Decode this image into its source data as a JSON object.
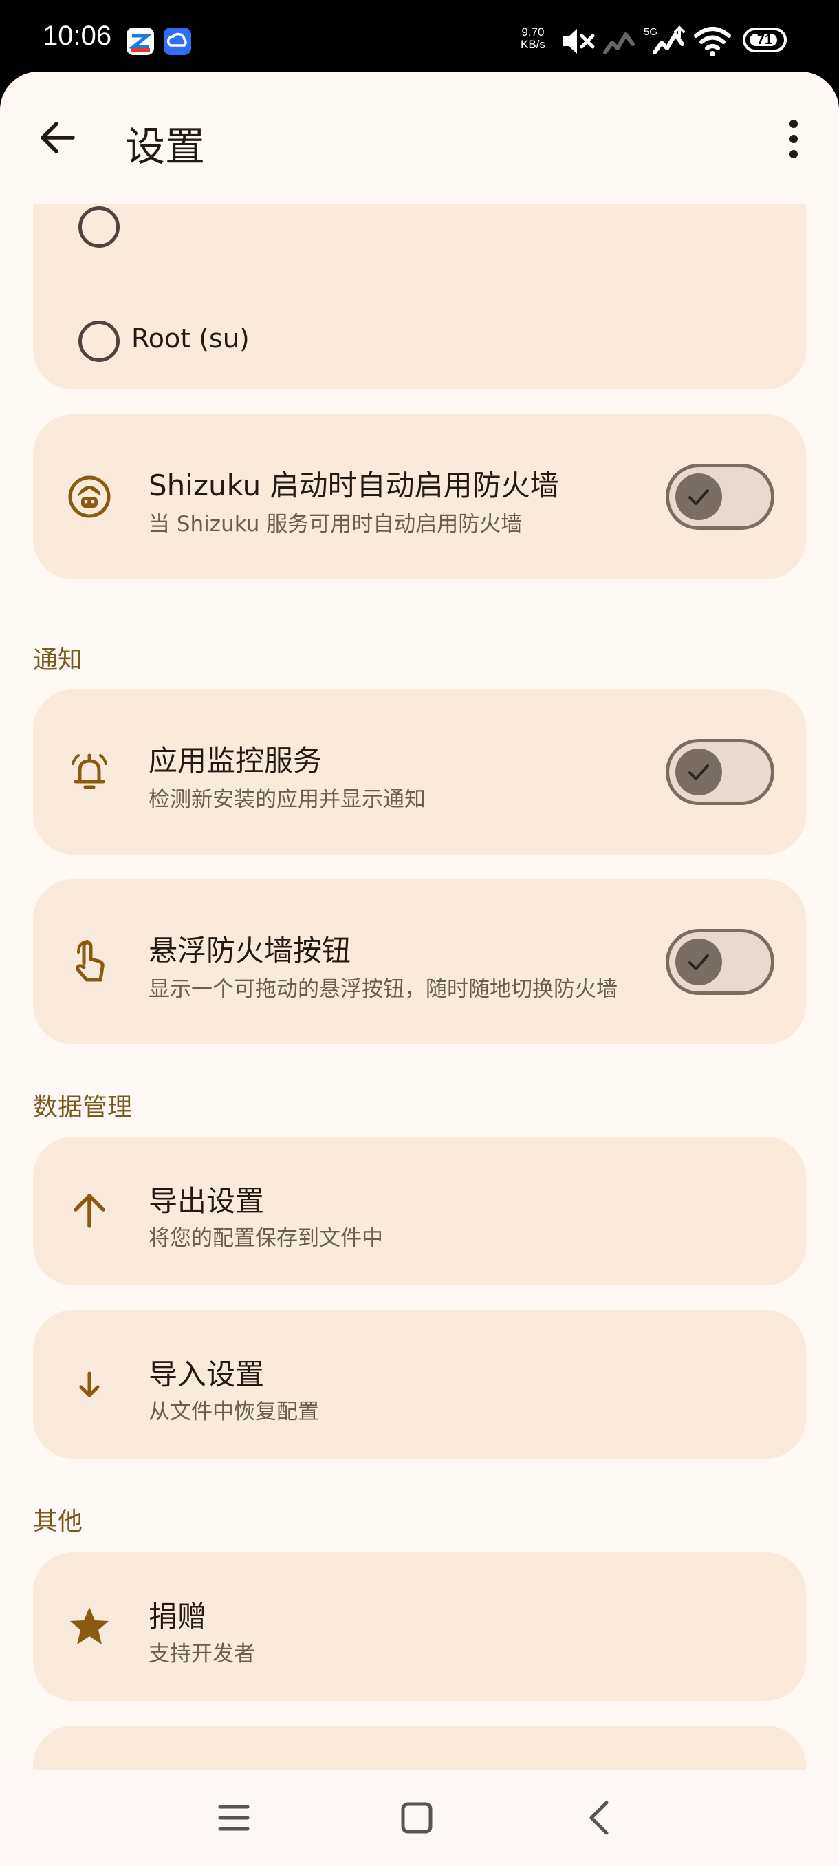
{
  "status_bar": {
    "time": "10:06",
    "net_speed_value": "9.70",
    "net_speed_unit": "KB/s",
    "network_label": "5G",
    "battery": "71"
  },
  "header": {
    "title": "设置"
  },
  "mode_options": {
    "root_label": "Root (su)"
  },
  "firewall": {
    "title": "Shizuku 启动时自动启用防火墙",
    "subtitle": "当 Shizuku 服务可用时自动启用防火墙",
    "enabled": true
  },
  "notifications": {
    "section_title": "通知",
    "items": [
      {
        "title": "应用监控服务",
        "subtitle": "检测新安装的应用并显示通知",
        "enabled": true
      },
      {
        "title": "悬浮防火墙按钮",
        "subtitle": "显示一个可拖动的悬浮按钮，随时随地切换防火墙",
        "enabled": true
      }
    ]
  },
  "data_management": {
    "section_title": "数据管理",
    "items": [
      {
        "title": "导出设置",
        "subtitle": "将您的配置保存到文件中"
      },
      {
        "title": "导入设置",
        "subtitle": "从文件中恢复配置"
      }
    ]
  },
  "other": {
    "section_title": "其他",
    "items": [
      {
        "title": "捐赠",
        "subtitle": "支持开发者"
      }
    ]
  },
  "colors": {
    "background": "#fff8f5",
    "card": "#f9eadc",
    "accent": "#7a5a1c",
    "icon": "#8a5a10",
    "switch": "#7a6d63"
  },
  "icons": {
    "back": "arrow-left-icon",
    "more": "more-vert-icon",
    "firewall": "shizuku-icon",
    "monitor": "bell-ring-icon",
    "floating": "touch-icon",
    "export": "arrow-up-icon",
    "import": "arrow-down-icon",
    "donate": "star-icon"
  }
}
